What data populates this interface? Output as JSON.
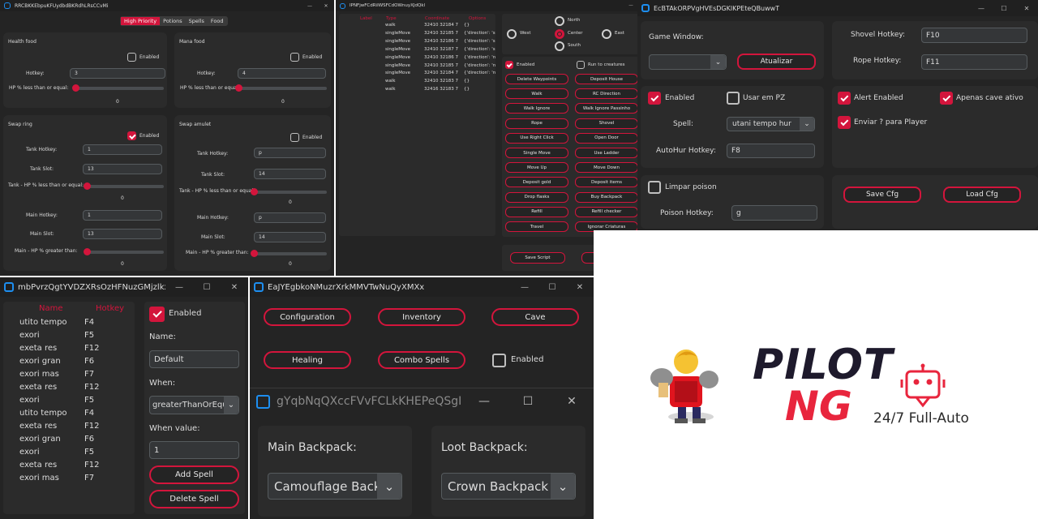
{
  "w1": {
    "title": "RRCBKKEbpuKFUydbdBKRdhLRsCCvMi",
    "tabs": [
      "High Priority",
      "Potions",
      "Spells",
      "Food"
    ],
    "health_food": {
      "title": "Health food",
      "enabled": "Enabled",
      "hotkey_label": "Hotkey:",
      "hotkey": "3",
      "hp_label": "HP % less than or equal:",
      "value": "0"
    },
    "mana_food": {
      "title": "Mana food",
      "enabled": "Enabled",
      "hotkey_label": "Hotkey:",
      "hotkey": "4",
      "hp_label": "HP % less than or equal:",
      "value": "0"
    },
    "swap_ring": {
      "title": "Swap ring",
      "enabled": "Enabled",
      "tank_hotkey_label": "Tank Hotkey:",
      "tank_hotkey": "1",
      "tank_slot_label": "Tank Slot:",
      "tank_slot": "13",
      "tank_hp_label": "Tank - HP % less than or equal:",
      "tank_value": "0",
      "main_hotkey_label": "Main Hotkey:",
      "main_hotkey": "1",
      "main_slot_label": "Main Slot:",
      "main_slot": "13",
      "main_hp_label": "Main - HP % greater than:",
      "main_value": "0"
    },
    "swap_amulet": {
      "title": "Swap amulet",
      "enabled": "Enabled",
      "tank_hotkey_label": "Tank Hotkey:",
      "tank_hotkey": "p",
      "tank_slot_label": "Tank Slot:",
      "tank_slot": "14",
      "tank_hp_label": "Tank - HP % less than or equal:",
      "tank_value": "0",
      "main_hotkey_label": "Main Hotkey:",
      "main_hotkey": "p",
      "main_slot_label": "Main Slot:",
      "main_slot": "14",
      "main_hp_label": "Main - HP % greater than:",
      "main_value": "0"
    }
  },
  "w2": {
    "title": "IPNFjwFCdRiIWSFCdOWnuyXJdQkl",
    "headers": [
      "Label",
      "Type",
      "Coordinate",
      "Options"
    ],
    "rows": [
      {
        "type": "walk",
        "coord": "32410 32184 7",
        "opt": "{}"
      },
      {
        "type": "singleMove",
        "coord": "32410 32185 7",
        "opt": "{'direction': 's"
      },
      {
        "type": "singleMove",
        "coord": "32410 32186 7",
        "opt": "{'direction': 's"
      },
      {
        "type": "singleMove",
        "coord": "32410 32187 7",
        "opt": "{'direction': 's"
      },
      {
        "type": "singleMove",
        "coord": "32410 32186 7",
        "opt": "{'direction': 'n"
      },
      {
        "type": "singleMove",
        "coord": "32410 32185 7",
        "opt": "{'direction': 'n"
      },
      {
        "type": "singleMove",
        "coord": "32410 32184 7",
        "opt": "{'direction': 'n"
      },
      {
        "type": "walk",
        "coord": "32410 32183 7",
        "opt": "{}"
      },
      {
        "type": "walk",
        "coord": "32416 32183 7",
        "opt": "{}"
      }
    ],
    "dirs": {
      "north": "North",
      "west": "West",
      "center": "Center",
      "east": "East",
      "south": "South"
    },
    "enabled": "Enabled",
    "run_to_creatures": "Run to creatures",
    "buttons": [
      "Delete Waypoints",
      "Deposit House",
      "Walk",
      "RC Direction",
      "Walk Ignore",
      "Walk Ignore Passinho",
      "Rope",
      "Shovel",
      "Use Right Click",
      "Open Door",
      "Single Move",
      "Use Ladder",
      "Move Up",
      "Move Down",
      "Deposit gold",
      "Deposit items",
      "Drop flasks",
      "Buy Backpack",
      "Refill",
      "Refill checker",
      "Travel",
      "Ignorar Criaturas"
    ],
    "save": "Save Script",
    "load": "Load Script"
  },
  "w3": {
    "title": "EcBTAkORPVgHVEsDGKlKPEteQBuwwT",
    "game_window": "Game Window:",
    "atualizar": "Atualizar",
    "enabled": "Enabled",
    "usar_pz": "Usar em PZ",
    "spell_label": "Spell:",
    "spell": "utani tempo hur",
    "autohur_label": "AutoHur Hotkey:",
    "autohur": "F8",
    "limpar": "Limpar poison",
    "poison_label": "Poison Hotkey:",
    "poison": "g",
    "shovel_label": "Shovel Hotkey:",
    "shovel": "F10",
    "rope_label": "Rope Hotkey:",
    "rope": "F11",
    "alert": "Alert Enabled",
    "apenas": "Apenas cave ativo",
    "enviar": "Enviar ? para Player",
    "save": "Save Cfg",
    "load": "Load Cfg"
  },
  "w4": {
    "title": "mbPvrzQgtYVDZXRsOzHFNuzGMjzlkx",
    "headers": [
      "Name",
      "Hotkey"
    ],
    "spells": [
      [
        "utito tempo",
        "F4"
      ],
      [
        "exori",
        "F5"
      ],
      [
        "exeta res",
        "F12"
      ],
      [
        "exori gran",
        "F6"
      ],
      [
        "exori mas",
        "F7"
      ],
      [
        "exeta res",
        "F12"
      ],
      [
        "exori",
        "F5"
      ],
      [
        "utito tempo",
        "F4"
      ],
      [
        "exeta res",
        "F12"
      ],
      [
        "exori gran",
        "F6"
      ],
      [
        "exori",
        "F5"
      ],
      [
        "exeta res",
        "F12"
      ],
      [
        "exori mas",
        "F7"
      ]
    ],
    "enabled": "Enabled",
    "name_label": "Name:",
    "name": "Default",
    "when_label": "When:",
    "when": "greaterThanOrEqu",
    "when_value_label": "When value:",
    "when_value": "1",
    "add": "Add Spell",
    "delete": "Delete Spell"
  },
  "w5": {
    "title": "EaJYEgbkoNMuzrXrkMMVTwNuQyXMXx",
    "buttons": [
      "Configuration",
      "Inventory",
      "Cave",
      "Healing",
      "Combo Spells"
    ],
    "enabled": "Enabled"
  },
  "w6": {
    "title": "gYqbNqQXccFVvFCLkKHEPeQSgI...",
    "main_label": "Main Backpack:",
    "main": "Camouflage Back|",
    "loot_label": "Loot Backpack:",
    "loot": "Crown Backpack"
  },
  "promo": {
    "line1": "PILOT",
    "line2": "NG",
    "tagline": "24/7 Full-Auto"
  },
  "colors": {
    "accent": "#d3153c",
    "bg": "#242424"
  }
}
